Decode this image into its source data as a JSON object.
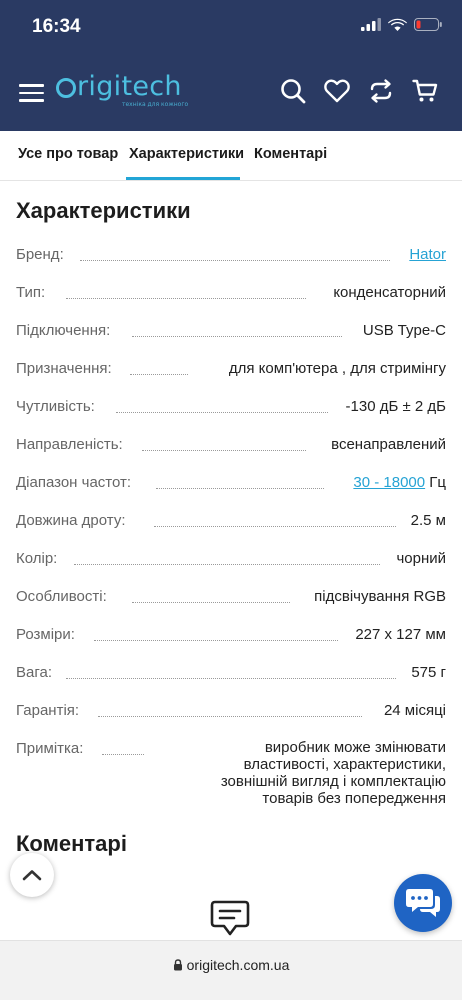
{
  "status_bar": {
    "time": "16:34"
  },
  "brand": {
    "logo_text": "rigitech",
    "tagline": "техніка для кожного"
  },
  "tabs": [
    {
      "label": "Усе про товар",
      "active": false
    },
    {
      "label": "Характеристики",
      "active": true
    },
    {
      "label": "Коментарі",
      "active": false
    }
  ],
  "specs": {
    "title": "Характеристики",
    "rows": [
      {
        "label": "Бренд:",
        "value": "Hator",
        "link": true
      },
      {
        "label": "Тип:",
        "value": "конденсаторний"
      },
      {
        "label": "Підключення:",
        "value": "USB Type-C"
      },
      {
        "label": "Призначення:",
        "value": "для комп'ютера , для стримінгу"
      },
      {
        "label": "Чутливість:",
        "value": "-130 дБ ± 2 дБ"
      },
      {
        "label": "Направленість:",
        "value": "всенаправлений"
      },
      {
        "label": "Діапазон частот:",
        "value": "30 - 18000",
        "unit": "Гц",
        "link": true
      },
      {
        "label": "Довжина дроту:",
        "value": "2.5 м"
      },
      {
        "label": "Колір:",
        "value": "чорний"
      },
      {
        "label": "Особливості:",
        "value": "підсвічування RGB"
      },
      {
        "label": "Розміри:",
        "value": "227 x 127 мм"
      },
      {
        "label": "Вага:",
        "value": "575 г"
      },
      {
        "label": "Гарантія:",
        "value": "24 місяці"
      },
      {
        "label": "Примітка:",
        "value": "виробник може змінювати властивості, характеристики, зовнішній вигляд і комплектацію товарів без попередження"
      }
    ]
  },
  "comments": {
    "title": "Коментарі"
  },
  "browser": {
    "url": "origitech.com.ua"
  },
  "colors": {
    "header_bg": "#2a3a63",
    "accent": "#22a5d6",
    "logo": "#4dbfe0",
    "chat": "#1f64c4"
  }
}
